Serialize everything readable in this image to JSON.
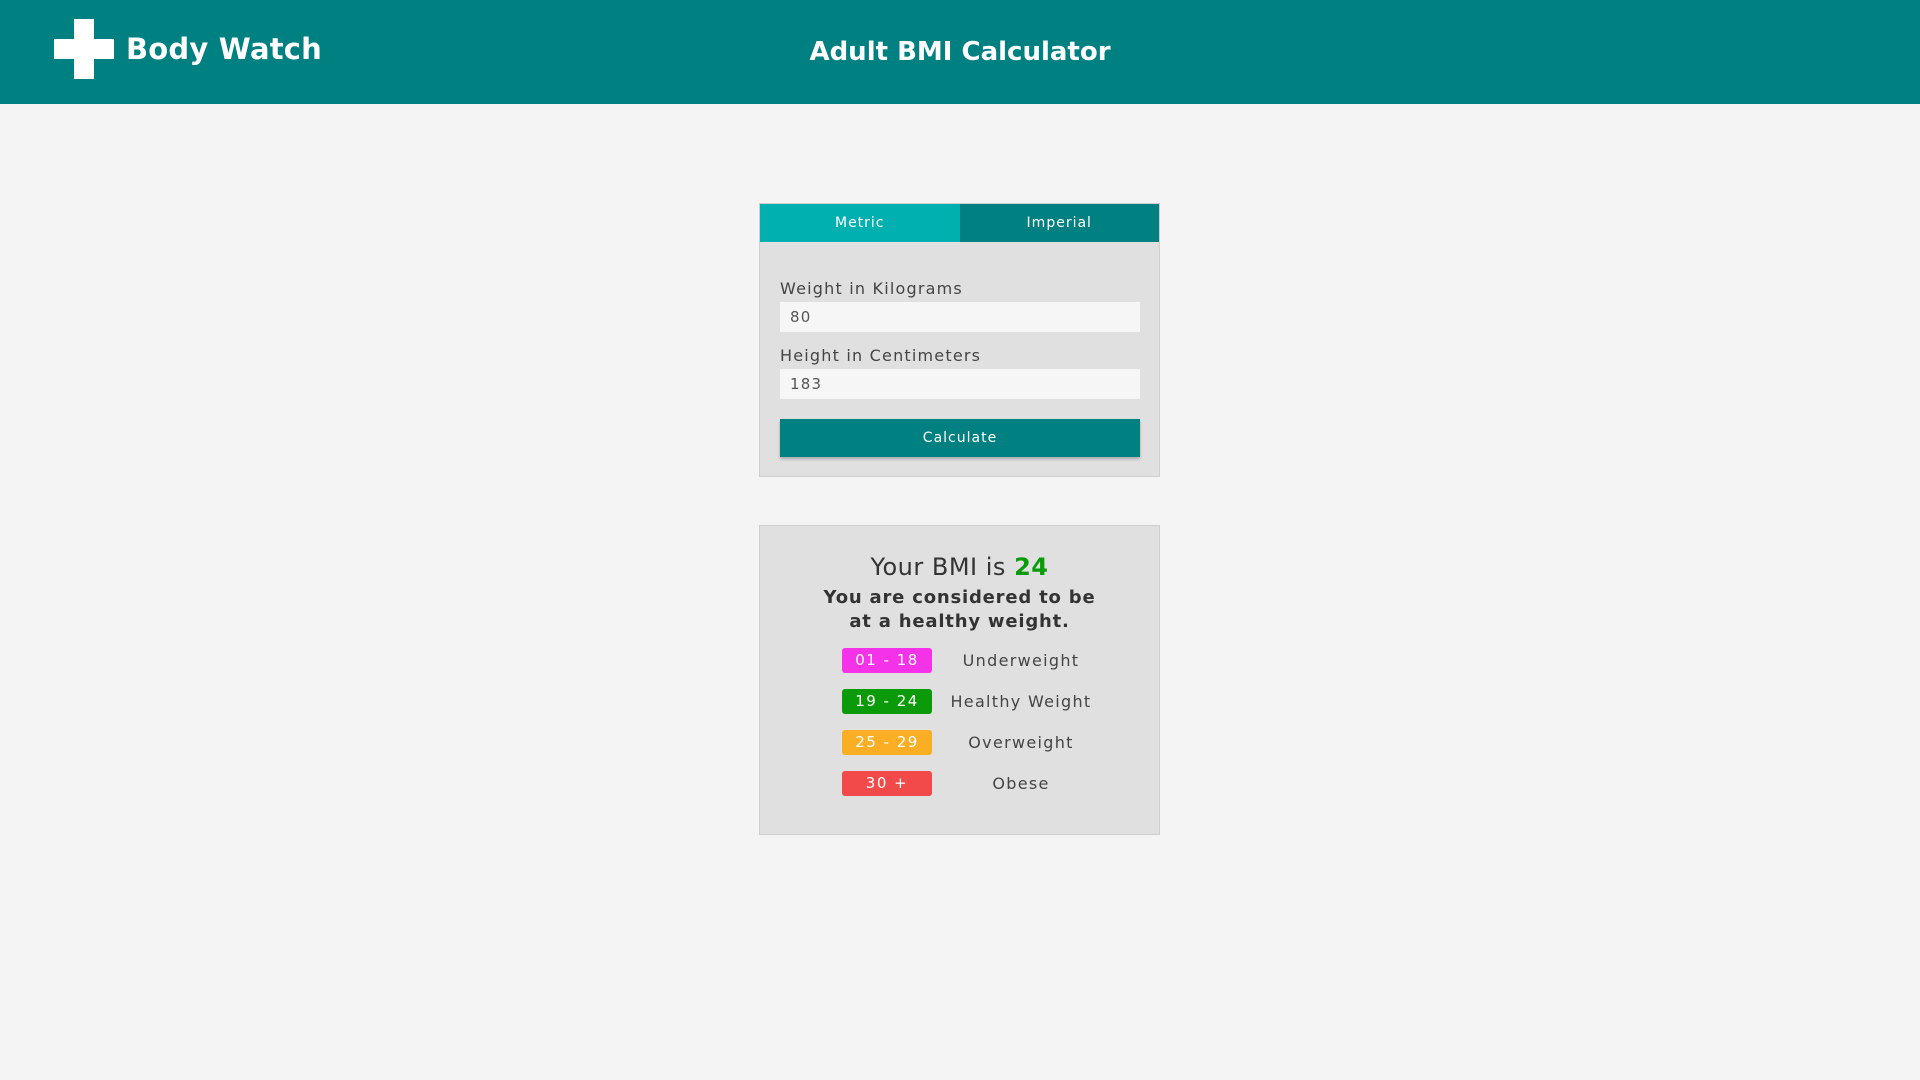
{
  "header": {
    "brand": "Body Watch",
    "title": "Adult BMI Calculator",
    "background": "#008080",
    "logo_icon": "cross-icon"
  },
  "calculator": {
    "tabs": [
      {
        "label": "Metric",
        "active": true
      },
      {
        "label": "Imperial",
        "active": false
      }
    ],
    "fields": {
      "weight": {
        "label": "Weight in Kilograms",
        "value": "80"
      },
      "height": {
        "label": "Height in Centimeters",
        "value": "183"
      }
    },
    "button_label": "Calculate",
    "colors": {
      "tab_active": "#00b0b0",
      "tab_inactive": "#008080",
      "button": "#008080"
    }
  },
  "result": {
    "prefix": "Your BMI is ",
    "value": "24",
    "message": "You are considered to be at a healthy weight.",
    "scale": [
      {
        "range": "01 - 18",
        "label": "Underweight",
        "color": "#f433e8"
      },
      {
        "range": "19 - 24",
        "label": "Healthy Weight",
        "color": "#0a9a0a"
      },
      {
        "range": "25 - 29",
        "label": "Overweight",
        "color": "#f9ae24"
      },
      {
        "range": "30 +",
        "label": "Obese",
        "color": "#f24a4a"
      }
    ]
  }
}
